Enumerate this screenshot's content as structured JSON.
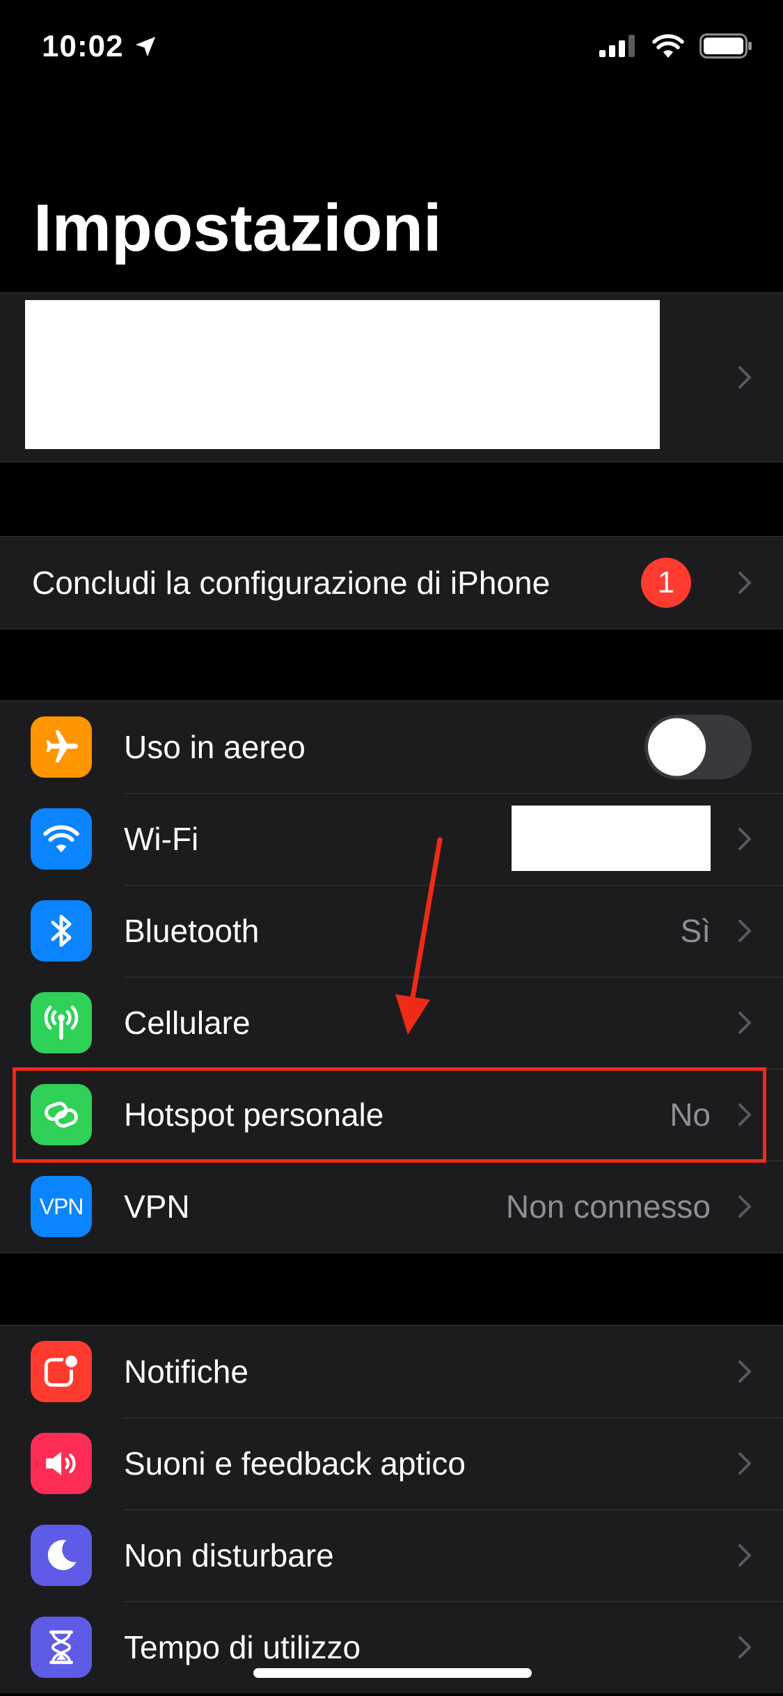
{
  "status_bar": {
    "time": "10:02"
  },
  "page": {
    "title": "Impostazioni"
  },
  "setup": {
    "label": "Concludi la configurazione di iPhone",
    "badge": "1"
  },
  "connectivity": {
    "airplane": {
      "label": "Uso in aereo",
      "icon": "airplane-icon",
      "color": "#ff9500",
      "toggle_on": false
    },
    "wifi": {
      "label": "Wi-Fi",
      "icon": "wifi-icon",
      "color": "#0a84ff"
    },
    "bluetooth": {
      "label": "Bluetooth",
      "value": "Sì",
      "icon": "bluetooth-icon",
      "color": "#0a84ff"
    },
    "cellular": {
      "label": "Cellulare",
      "icon": "antenna-icon",
      "color": "#30d158"
    },
    "hotspot": {
      "label": "Hotspot personale",
      "value": "No",
      "icon": "hotspot-icon",
      "color": "#30d158"
    },
    "vpn": {
      "label": "VPN",
      "value": "Non connesso",
      "icon_text": "VPN",
      "icon": "vpn-icon",
      "color": "#0a84ff"
    }
  },
  "general": {
    "notifications": {
      "label": "Notifiche",
      "icon": "notifications-icon",
      "color": "#ff3b30"
    },
    "sounds": {
      "label": "Suoni e feedback aptico",
      "icon": "speaker-icon",
      "color": "#ff2d55"
    },
    "dnd": {
      "label": "Non disturbare",
      "icon": "moon-icon",
      "color": "#5e5ce6"
    },
    "screen_time": {
      "label": "Tempo di utilizzo",
      "icon": "hourglass-icon",
      "color": "#5e5ce6"
    }
  },
  "annotation": {
    "color": "#ee2a18"
  }
}
